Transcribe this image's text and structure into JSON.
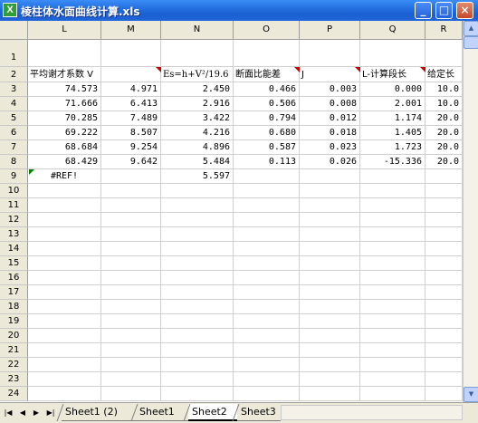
{
  "window": {
    "title": "棱柱体水面曲线计算.xls",
    "icon_label": "X",
    "min_label": "_",
    "max_label": "□",
    "close_label": "×"
  },
  "columns": [
    "L",
    "M",
    "N",
    "O",
    "P",
    "Q",
    "R"
  ],
  "rows": [
    "1",
    "2",
    "3",
    "4",
    "5",
    "6",
    "7",
    "8",
    "9",
    "10",
    "11",
    "12",
    "13",
    "14",
    "15",
    "16",
    "17",
    "18",
    "19",
    "20",
    "21",
    "22",
    "23",
    "24"
  ],
  "header_row": {
    "L": "平均谢才系数 V",
    "N": "Es=h+V²/19.6",
    "O": "断面比能差",
    "P": "J",
    "Q": "L-计算段长",
    "R": "给定长"
  },
  "data_rows": [
    {
      "row": "3",
      "L": "74.573",
      "M": "4.971",
      "N": "2.450",
      "O": "0.466",
      "P": "0.003",
      "Q": "0.000",
      "R": "10.0"
    },
    {
      "row": "4",
      "L": "71.666",
      "M": "6.413",
      "N": "2.916",
      "O": "0.506",
      "P": "0.008",
      "Q": "2.001",
      "R": "10.0"
    },
    {
      "row": "5",
      "L": "70.285",
      "M": "7.489",
      "N": "3.422",
      "O": "0.794",
      "P": "0.012",
      "Q": "1.174",
      "R": "20.0"
    },
    {
      "row": "6",
      "L": "69.222",
      "M": "8.507",
      "N": "4.216",
      "O": "0.680",
      "P": "0.018",
      "Q": "1.405",
      "R": "20.0"
    },
    {
      "row": "7",
      "L": "68.684",
      "M": "9.254",
      "N": "4.896",
      "O": "0.587",
      "P": "0.023",
      "Q": "1.723",
      "R": "20.0"
    },
    {
      "row": "8",
      "L": "68.429",
      "M": "9.642",
      "N": "5.484",
      "O": "0.113",
      "P": "0.026",
      "Q": "-15.336",
      "R": "20.0"
    }
  ],
  "row9": {
    "L": "#REF!",
    "N": "5.597"
  },
  "sheets": [
    "Sheet1 (2)",
    "Sheet1",
    "Sheet2",
    "Sheet3"
  ],
  "active_sheet": "Sheet2",
  "nav": {
    "first": "|◀",
    "prev": "◀",
    "next": "▶",
    "last": "▶|"
  },
  "colors": {
    "titlebar": "#2470e0",
    "header_bg": "#ece9d8",
    "comment": "#cc0000"
  }
}
